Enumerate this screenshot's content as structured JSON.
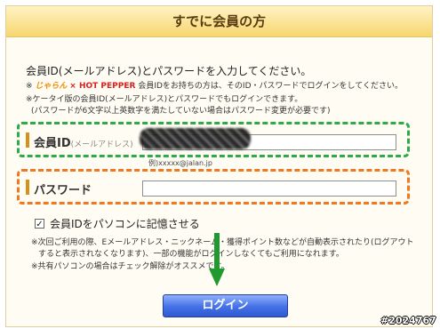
{
  "header": {
    "title": "すでに会員の方"
  },
  "intro": "会員ID(メールアドレス)とパスワードを入力してください。",
  "notes": {
    "brand_jalan": "じゃらん",
    "brand_hotpepper": "× HOT PEPPER",
    "line1": "会員IDをお持ちの方は、そのID・パスワードでログインをしてください。",
    "line2": "※ケータイ版の会員ID(メールアドレス)とパスワードでもログインできます。",
    "line3": "(パスワードが6文字以上英数字を満たしていない場合はパスワード変更が必要です)"
  },
  "form": {
    "id_label": "会員ID",
    "id_sublabel": "(メールアドレス)",
    "id_value": "",
    "id_example": "例)xxxxx@jalan.jp",
    "pw_label": "パスワード",
    "pw_value": ""
  },
  "remember": {
    "label": "会員IDをパソコンに記憶させる",
    "checked": true
  },
  "caution": {
    "line1": "※次回ご利用の際、Eメールアドレス・ニックネーム・獲得ポイント数などが自動表示されたり(ログアウト",
    "line2": "すると表示されなくなります)、一部の機能がログインしなくてもご利用になれます。",
    "line3": "※共有パソコンの場合はチェック解除がオススメです。"
  },
  "buttons": {
    "login": "ログイン"
  },
  "watermark": "#2024767",
  "colors": {
    "header_gradient_top": "#fff3c4",
    "header_gradient_bottom": "#f7d66e",
    "id_highlight": "#2eaa4a",
    "pw_highlight": "#f07820",
    "arrow": "#1f9a2e",
    "login_button": "#4470e6"
  },
  "icons": {
    "check": "check-icon",
    "arrow": "arrow-down-icon"
  }
}
